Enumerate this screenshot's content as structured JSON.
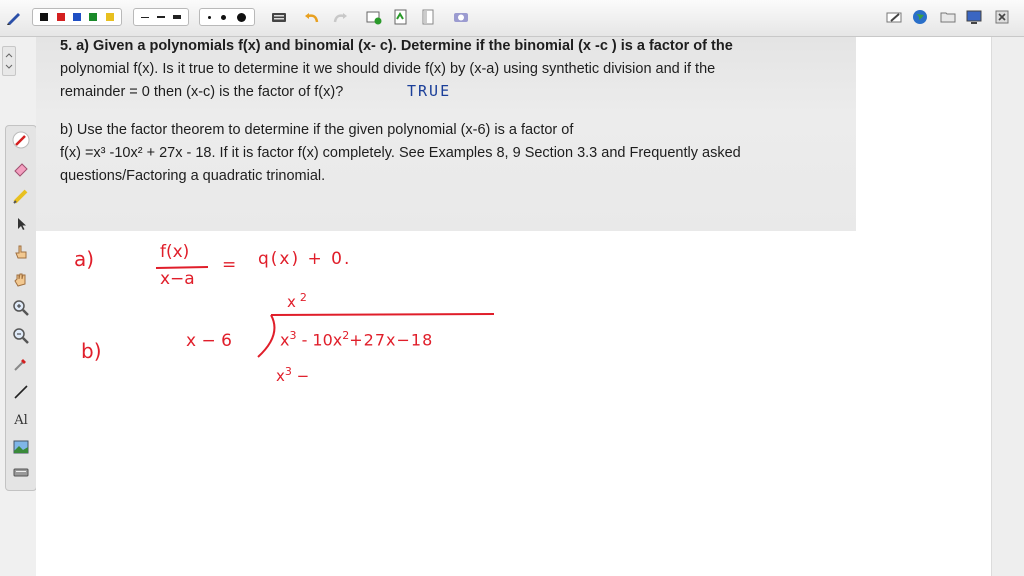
{
  "toolbar": {
    "palette_colors": [
      "#111111",
      "#d42020",
      "#1f4fc4",
      "#1a8a2a",
      "#e8c020"
    ],
    "icons": [
      "pen-icon",
      "line-style-icon",
      "dot-size-icon",
      "keyboard-icon",
      "undo-icon",
      "redo-icon",
      "add-page-icon",
      "document-icon",
      "clear-icon",
      "camera-icon",
      "eraser-toolbar-icon",
      "globe-icon",
      "folder-icon",
      "display-icon",
      "close-icon"
    ]
  },
  "side_tools": {
    "text_tool_label": "Al"
  },
  "question": {
    "part_a_line1_bold": "5. a) Given a polynomials f(x) and binomial (x- c). Determine if the binomial (x -c ) is a factor of the",
    "part_a_line2": "polynomial f(x). Is it true to determine it we should divide f(x) by (x-a) using synthetic division and if the",
    "part_a_line3": "remainder = 0 then (x-c) is the factor of f(x)?",
    "part_b_line1": "b) Use the factor theorem to determine if the given polynomial (x-6) is a factor of",
    "part_b_line2": "f(x) =x³ -10x² + 27x - 18. If it is factor f(x) completely.  See Examples 8, 9 Section 3.3 and Frequently asked",
    "part_b_line3": "questions/Factoring a quadratic trinomial."
  },
  "annotation": {
    "true_text": "TRUE",
    "color": "#1b3f99"
  },
  "handwriting": {
    "color": "#e01e2a",
    "label_a": "a)",
    "numerator": "f(x)",
    "denominator": "x−a",
    "equals": "=",
    "rhs": "q(x) + 0.",
    "label_b": "b)",
    "divisor": "x − 6",
    "quotient_term": "x",
    "quotient_exp": "2",
    "dividend": "x",
    "dividend_parts": [
      "3",
      "- 10x",
      "2",
      "+27x−18"
    ],
    "work_term": "x",
    "work_exp": "3",
    "work_op": "−"
  }
}
